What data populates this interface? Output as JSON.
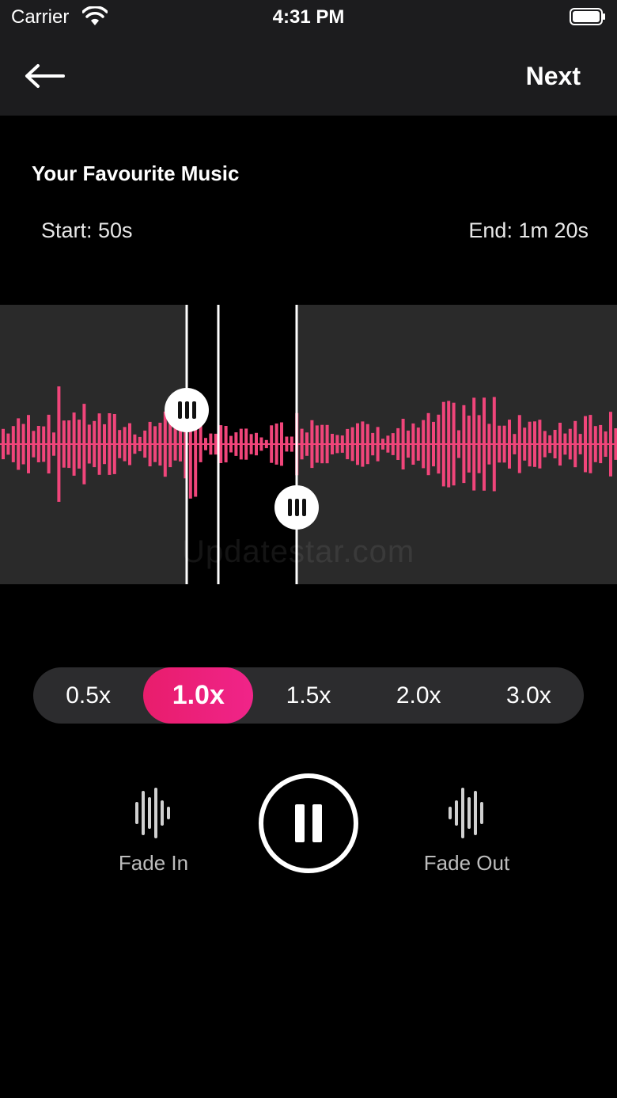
{
  "status_bar": {
    "carrier": "Carrier",
    "time": "4:31 PM"
  },
  "nav": {
    "next_label": "Next",
    "back_icon": "arrow-left-icon"
  },
  "track": {
    "title": "Your Favourite Music",
    "start_label": "Start: 50s",
    "end_label": "End: 1m 20s"
  },
  "waveform": {
    "watermark": "Updatestar.com",
    "color": "#f0457a"
  },
  "speed": {
    "options": [
      "0.5x",
      "1.0x",
      "1.5x",
      "2.0x",
      "3.0x"
    ],
    "selected": "1.0x"
  },
  "controls": {
    "fade_in_label": "Fade In",
    "fade_out_label": "Fade Out",
    "play_state": "pause"
  },
  "colors": {
    "accent": "#e81d6c",
    "background": "#000000",
    "bar": "#1c1c1e"
  }
}
